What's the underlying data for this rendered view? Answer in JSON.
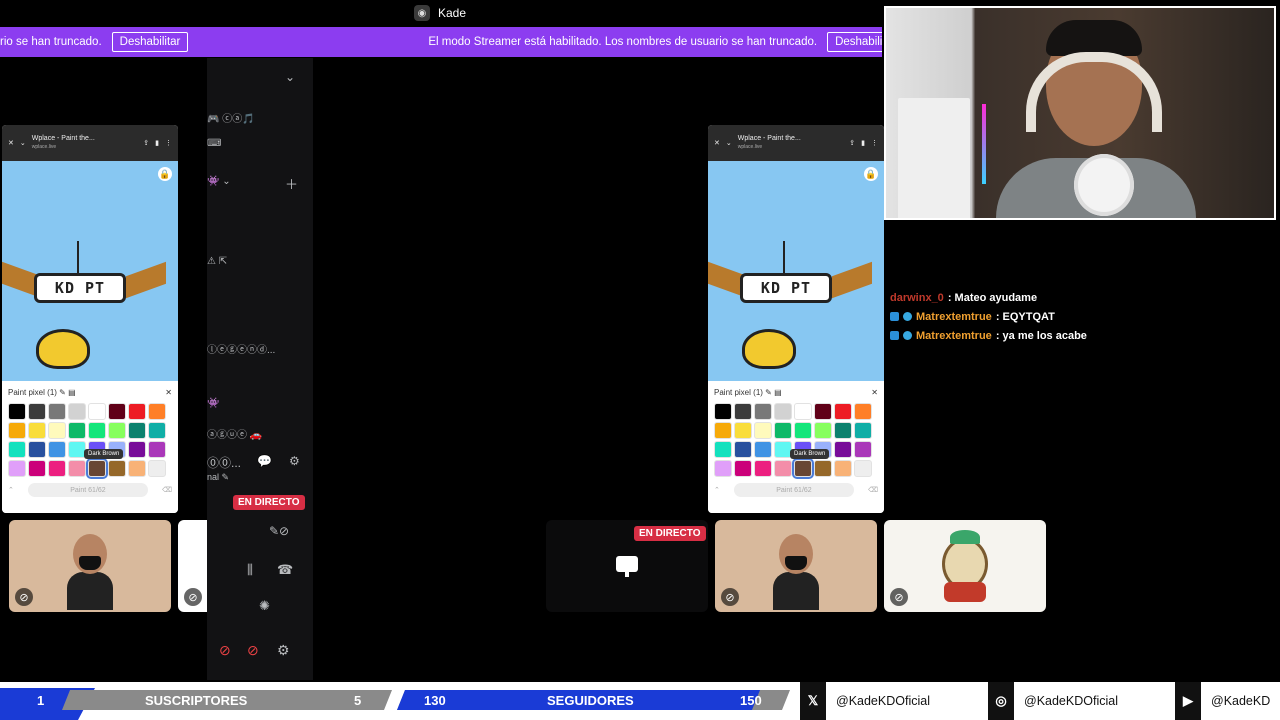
{
  "titlebar": {
    "title": "Kade"
  },
  "banner": {
    "message_partial": "rio se han truncado.",
    "message": "El modo Streamer está habilitado. Los nombres de usuario se han truncado.",
    "button_label": "Deshabilitar",
    "button_label_partial": "Deshabilita",
    "color": "#8c3df0"
  },
  "sidepanel": {
    "lines": [
      "🎮 ⓒⓐ🎵",
      "⌨",
      "👾 ⌄",
      "＋",
      "⚠ ⇱",
      "ⓛⓔⓖⓔⓝⓓ...",
      "👾",
      "ⓐⓖⓤⓔ 🚗",
      "⓪⓪...",
      "nal ✎"
    ],
    "live_label": "EN DIRECTO"
  },
  "phone": {
    "tab_title": "Wplace - Paint the...",
    "tab_url": "wplace.live",
    "sign_text": "KD PT",
    "palette_title": "Paint pixel",
    "palette_count": "(1)",
    "tooltip": "Dark Brown",
    "paint_button": "Paint 61/62",
    "swatches": [
      "#000000",
      "#3c3c3c",
      "#787878",
      "#d2d2d2",
      "#ffffff",
      "#600018",
      "#ed1c24",
      "#ff7f27",
      "#f6aa09",
      "#f9dd3b",
      "#fffabc",
      "#0eb968",
      "#13e67b",
      "#87ff5e",
      "#0c816e",
      "#10aea6",
      "#13e1be",
      "#28509e",
      "#4093e4",
      "#60f7f2",
      "#6b50f6",
      "#99b1fb",
      "#780c99",
      "#aa38b9",
      "#e09ff9",
      "#cb007a",
      "#ec1f80",
      "#f38da9",
      "#684634",
      "#95682a",
      "#f8b277",
      "#eeeeee"
    ],
    "selected_index": 28
  },
  "stage": {
    "live_label": "EN DIRECTO"
  },
  "chat": {
    "messages": [
      {
        "user": "darwinx_0",
        "text": ": Mateo ayudame",
        "color": "#c0392b"
      },
      {
        "user": "Matrextemtrue",
        "text": ": EQYTQAT",
        "color": "#f0a030"
      },
      {
        "user": "Matrextemtrue",
        "text": ": ya me los acabe",
        "color": "#f0a030"
      }
    ]
  },
  "bottombar": {
    "subs_current": "1",
    "subs_label": "SUSCRIPTORES",
    "subs_goal": "5",
    "followers_current": "130",
    "followers_label": "SEGUIDORES",
    "followers_goal": "150",
    "twitter": "@KadeKDOficial",
    "instagram": "@KadeKDOficial",
    "youtube": "@KadeKD",
    "accent": "#1a3bd6"
  }
}
